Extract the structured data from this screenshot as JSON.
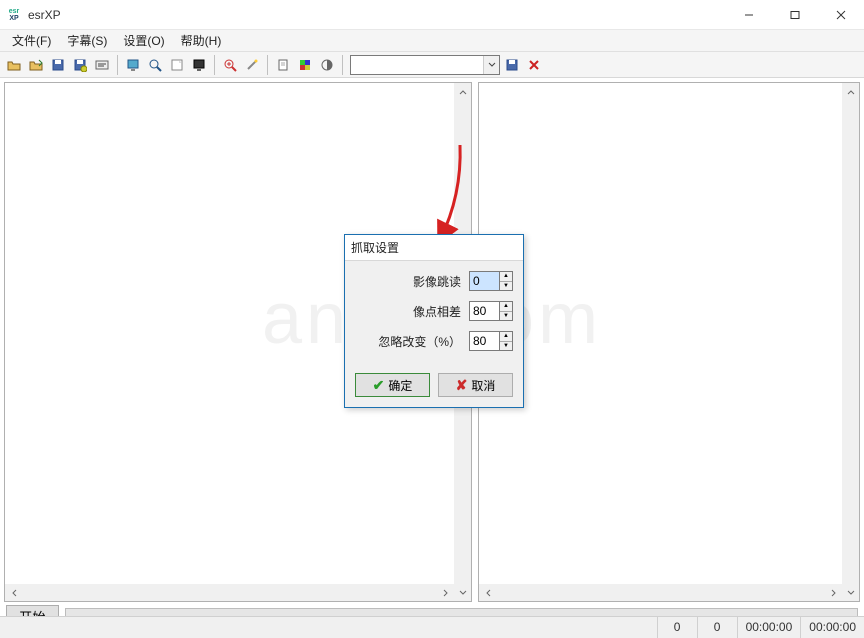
{
  "window": {
    "title": "esrXP",
    "icon_line1": "esr",
    "icon_line2": "XP"
  },
  "menu": {
    "file": "文件(F)",
    "subtitle": "字幕(S)",
    "settings": "设置(O)",
    "help": "帮助(H)"
  },
  "toolbar": {
    "combo_value": "",
    "icons": {
      "open": "open-folder-icon",
      "import": "import-icon",
      "save": "save-icon",
      "save_disk": "save-disk-icon",
      "sub": "subtitle-icon",
      "screen": "screen-icon",
      "zoom": "magnifier-icon",
      "note": "note-icon",
      "monitor": "monitor-icon",
      "zoom_in": "zoom-in-icon",
      "wand": "wand-icon",
      "doc": "document-icon",
      "color": "color-swatch-icon",
      "adjust": "adjust-icon",
      "disk2": "diskette-icon",
      "delete": "delete-x-icon"
    }
  },
  "bottom": {
    "start_label": "开始"
  },
  "status": {
    "v1": "0",
    "v2": "0",
    "t1": "00:00:00",
    "t2": "00:00:00"
  },
  "dialog": {
    "title": "抓取设置",
    "row1_label": "影像跳读",
    "row1_value": "0",
    "row2_label": "像点相差",
    "row2_value": "80",
    "row3_label": "忽略改变（%）",
    "row3_value": "80",
    "ok_label": "确定",
    "cancel_label": "取消"
  },
  "watermark": "anxz.com"
}
